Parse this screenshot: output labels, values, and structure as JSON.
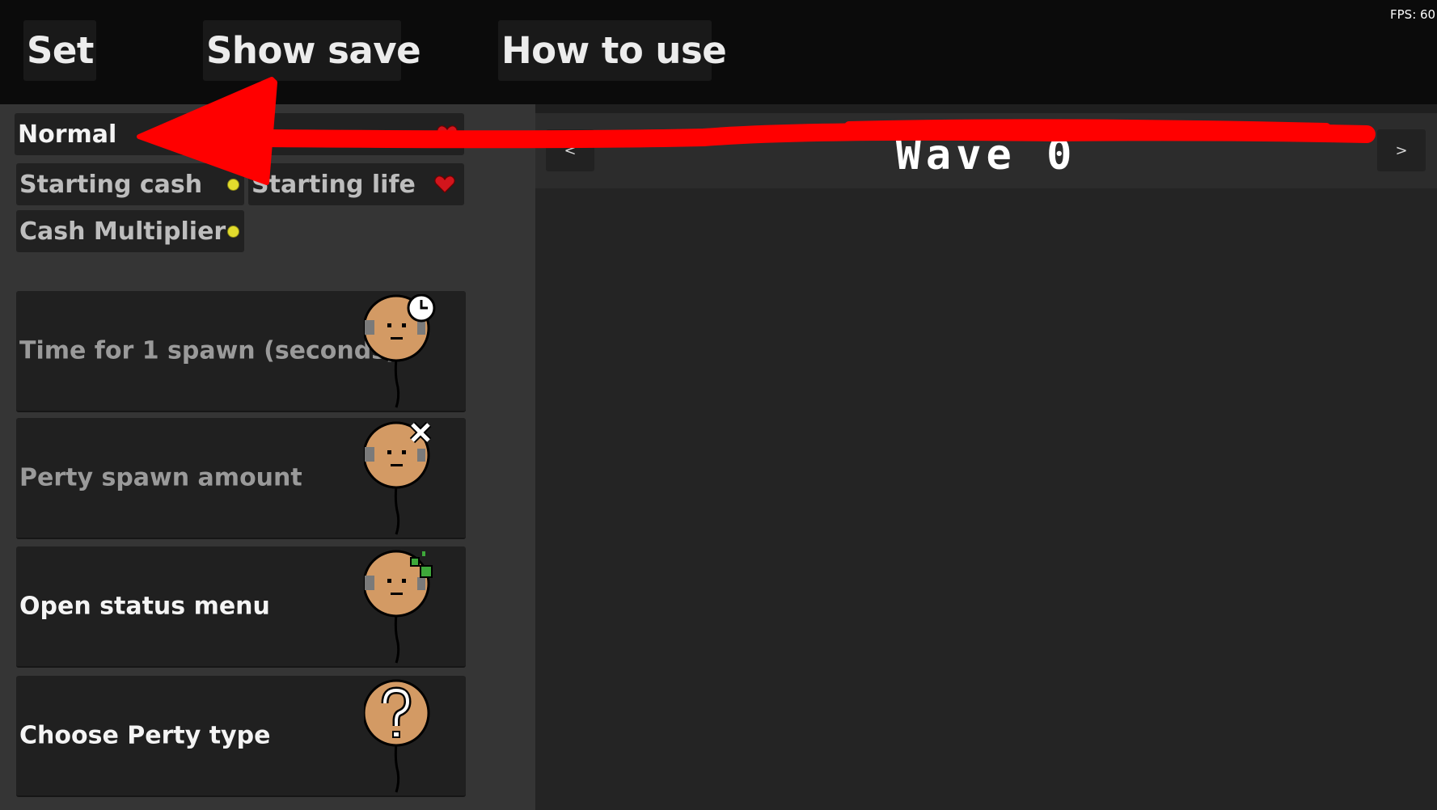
{
  "toolbar": {
    "set_label": "Set",
    "show_save_label": "Show save",
    "how_to_use_label": "How to use",
    "fps": "FPS: 60"
  },
  "settings": {
    "difficulty": "Normal",
    "starting_cash": "Starting cash",
    "starting_life": "Starting life",
    "cash_multiplier": "Cash Multiplier"
  },
  "cards": [
    {
      "label": "Time for 1 spawn (seconds)",
      "icon": "clock-badge"
    },
    {
      "label": "Perty spawn amount",
      "icon": "x-badge"
    },
    {
      "label": "Open status menu",
      "icon": "green-sparkle-badge"
    },
    {
      "label": "Choose Perty type",
      "icon": "question-mark"
    }
  ],
  "wave": {
    "title": "Wave 0",
    "prev_label": "<",
    "next_label": ">"
  },
  "colors": {
    "annotation_red": "#ff0000",
    "coin": "#e2dc2d",
    "heart": "#d2151c",
    "perty_skin": "#d39a64"
  }
}
